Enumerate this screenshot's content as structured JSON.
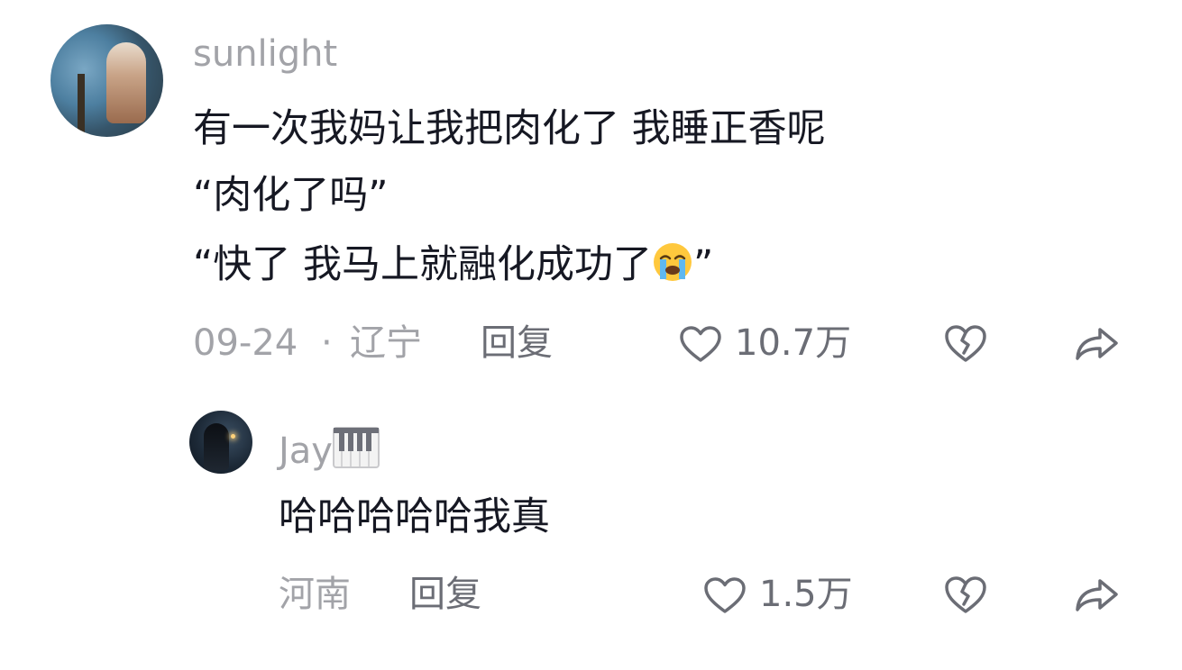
{
  "comment": {
    "username": "sunlight",
    "lines": [
      "有一次我妈让我把肉化了 我睡正香呢",
      "“肉化了吗”",
      "“快了 我马上就融化成功了",
      "”"
    ],
    "date": "09-24",
    "separator": "·",
    "location": "辽宁",
    "reply_label": "回复",
    "like_count": "10.7万"
  },
  "reply": {
    "username": "Jay",
    "text": "哈哈哈哈哈我真",
    "location": "河南",
    "reply_label": "回复",
    "like_count": "1.5万"
  },
  "icons": {
    "like": "heart-outline-icon",
    "dislike": "broken-heart-icon",
    "share": "share-arrow-icon",
    "cry_emoji": "loudly-crying-face-emoji",
    "piano_emoji": "piano-keys-emoji"
  }
}
